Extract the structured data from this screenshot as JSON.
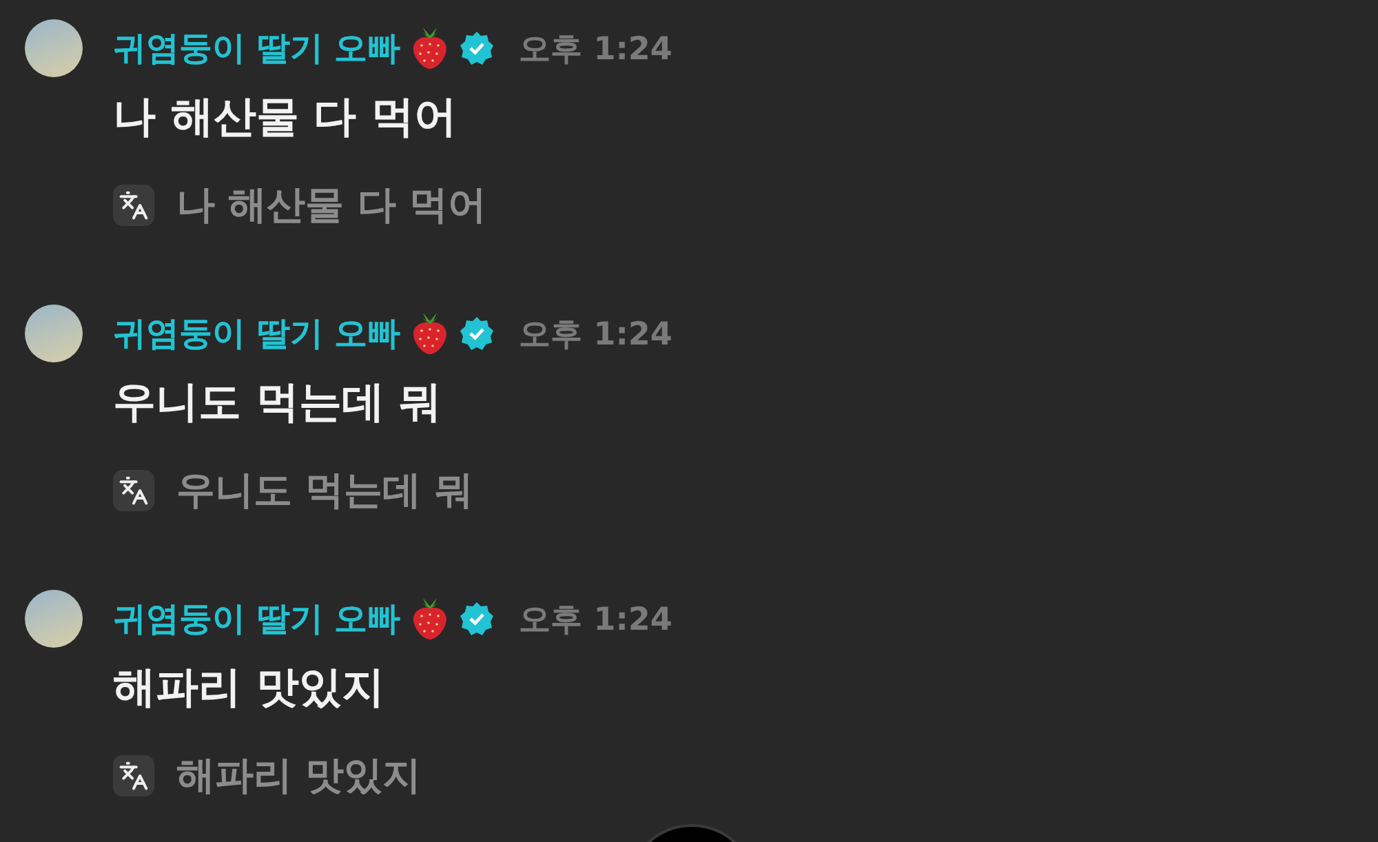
{
  "messages": [
    {
      "author": "귀염둥이 딸기 오빠",
      "verified": true,
      "time": "오후 1:24",
      "text": "나 해산물 다 먹어",
      "translation": "나 해산물 다 먹어"
    },
    {
      "author": "귀염둥이 딸기 오빠",
      "verified": true,
      "time": "오후 1:24",
      "text": "우니도 먹는데 뭐",
      "translation": "우니도 먹는데 뭐"
    },
    {
      "author": "귀염둥이 딸기 오빠",
      "verified": true,
      "time": "오후 1:24",
      "text": "해파리 맛있지",
      "translation": "해파리 맛있지"
    }
  ]
}
